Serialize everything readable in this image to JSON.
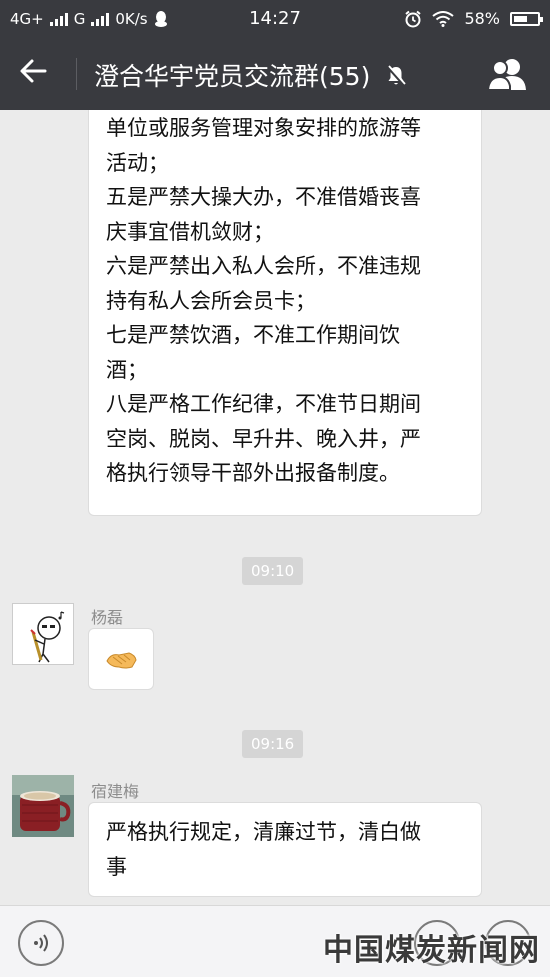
{
  "status_bar": {
    "network_4g": "4G+",
    "network_g": "G",
    "speed": "0K/s",
    "time": "14:27",
    "battery": "58%",
    "battery_level": 0.58
  },
  "header": {
    "title": "澄合华宇党员交流群(55)"
  },
  "messages": [
    {
      "lines": [
        "单位或服务管理对象安排的旅游等",
        "活动；",
        "五是严禁大操大办，不准借婚丧喜",
        "庆事宜借机敛财；",
        "六是严禁出入私人会所，不准违规",
        "持有私人会所会员卡；",
        "七是严禁饮酒，不准工作期间饮",
        "酒；",
        "八是严格工作纪律，不准节日期间",
        "空岗、脱岗、早升井、晚入井，严",
        "格执行领导干部外出报备制度。"
      ]
    },
    {
      "timestamp": "09:10"
    },
    {
      "sender": "杨磊",
      "emoji": "handshake-emoji"
    },
    {
      "timestamp": "09:16"
    },
    {
      "sender": "宿建梅",
      "lines": [
        "严格执行规定，清廉过节，清白做",
        "事"
      ]
    }
  ],
  "watermark": "中国煤炭新闻网",
  "colors": {
    "header_bg": "#393a3f",
    "chat_bg": "#ebebeb",
    "bubble_bg": "#ffffff",
    "timestamp_bg": "#d5d5d5"
  }
}
